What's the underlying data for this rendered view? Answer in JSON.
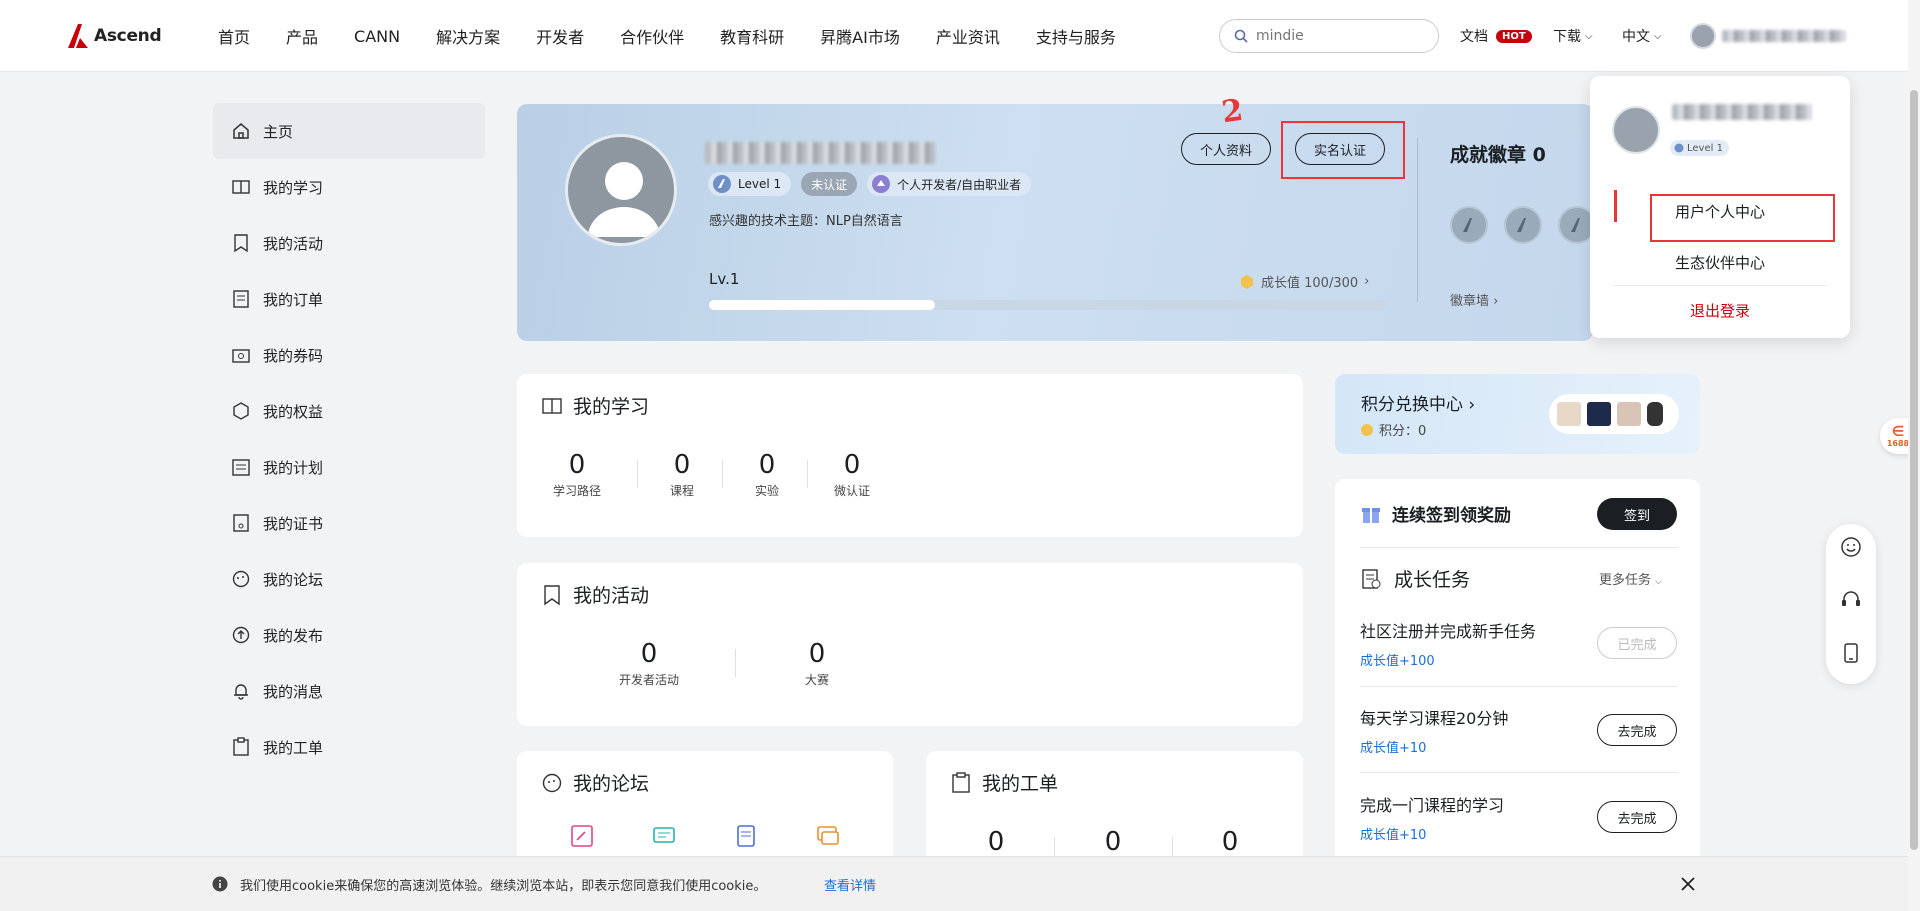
{
  "header": {
    "logo_text": "Ascend",
    "nav": [
      "首页",
      "产品",
      "CANN",
      "解决方案",
      "开发者",
      "合作伙伴",
      "教育科研",
      "昇腾AI市场",
      "产业资讯",
      "支持与服务"
    ],
    "search_placeholder": "mindie",
    "docs_label": "文档",
    "hot_badge": "HOT",
    "download_label": "下载",
    "language_label": "中文"
  },
  "sidebar": {
    "items": [
      {
        "label": "主页",
        "icon": "home-icon"
      },
      {
        "label": "我的学习",
        "icon": "book-icon"
      },
      {
        "label": "我的活动",
        "icon": "activity-icon"
      },
      {
        "label": "我的订单",
        "icon": "order-icon"
      },
      {
        "label": "我的券码",
        "icon": "coupon-icon"
      },
      {
        "label": "我的权益",
        "icon": "benefit-icon"
      },
      {
        "label": "我的计划",
        "icon": "plan-icon"
      },
      {
        "label": "我的证书",
        "icon": "certificate-icon"
      },
      {
        "label": "我的论坛",
        "icon": "forum-icon"
      },
      {
        "label": "我的发布",
        "icon": "publish-icon"
      },
      {
        "label": "我的消息",
        "icon": "bell-icon"
      },
      {
        "label": "我的工单",
        "icon": "ticket-icon"
      }
    ]
  },
  "profile": {
    "level_badge": "Level 1",
    "verify_badge": "未认证",
    "identity_badge": "个人开发者/自由职业者",
    "topic": "感兴趣的技术主题：NLP自然语言",
    "profile_btn": "个人资料",
    "verify_btn": "实名认证",
    "lv_label": "Lv.1",
    "growth_text": "成长值 100/300",
    "growth_progress": 0.3333,
    "achievements_title": "成就徽章 0",
    "medal_wall": "徽章墙"
  },
  "annotations": {
    "number": "2"
  },
  "study": {
    "title": "我的学习",
    "stats": [
      {
        "value": "0",
        "label": "学习路径"
      },
      {
        "value": "0",
        "label": "课程"
      },
      {
        "value": "0",
        "label": "实验"
      },
      {
        "value": "0",
        "label": "微认证"
      }
    ]
  },
  "activity": {
    "title": "我的活动",
    "stats": [
      {
        "value": "0",
        "label": "开发者活动"
      },
      {
        "value": "0",
        "label": "大赛"
      }
    ]
  },
  "forum": {
    "title": "我的论坛"
  },
  "ticket": {
    "title": "我的工单",
    "stats": [
      "0",
      "0",
      "0"
    ]
  },
  "points": {
    "title": "积分兑换中心",
    "balance": "积分：0"
  },
  "checkin": {
    "title": "连续签到领奖励",
    "button": "签到"
  },
  "tasks": {
    "title": "成长任务",
    "more": "更多任务",
    "items": [
      {
        "title": "社区注册并完成新手任务",
        "reward": "成长值+100",
        "button": "已完成"
      },
      {
        "title": "每天学习课程20分钟",
        "reward": "成长值+10",
        "button": "去完成"
      },
      {
        "title": "完成一门课程的学习",
        "reward": "成长值+10",
        "button": "去完成"
      }
    ]
  },
  "dropdown": {
    "level": "Level 1",
    "items": [
      "用户个人中心",
      "生态伙伴中心"
    ],
    "logout": "退出登录"
  },
  "cookie": {
    "text": "我们使用cookie来确保您的高速浏览体验。继续浏览本站，即表示您同意我们使用cookie。",
    "link": "查看详情"
  },
  "side_float": {
    "badge": "1688"
  }
}
